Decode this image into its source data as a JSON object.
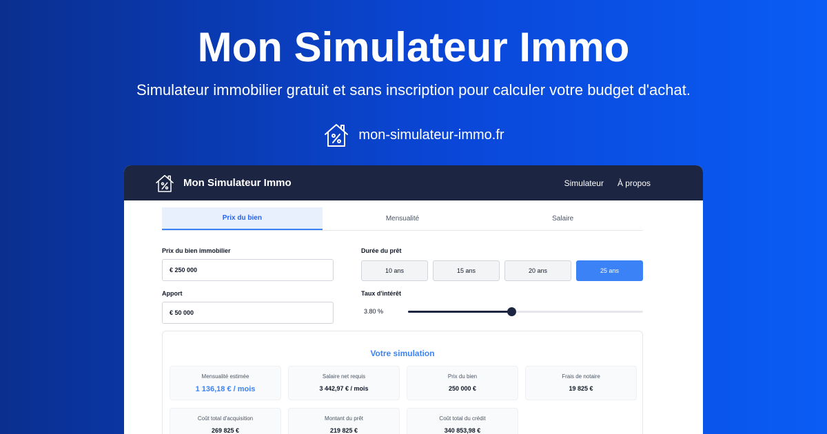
{
  "hero": {
    "title": "Mon Simulateur Immo",
    "subtitle": "Simulateur immobilier gratuit et sans inscription pour calculer votre budget d'achat.",
    "domain": "mon-simulateur-immo.fr",
    "logo_icon": "house-percent-icon"
  },
  "navbar": {
    "brand": "Mon Simulateur Immo",
    "links": [
      "Simulateur",
      "À propos"
    ]
  },
  "tabs": [
    {
      "label": "Prix du bien",
      "active": true
    },
    {
      "label": "Mensualité",
      "active": false
    },
    {
      "label": "Salaire",
      "active": false
    }
  ],
  "form": {
    "price_label": "Prix du bien immobilier",
    "price_value": "€ 250 000",
    "apport_label": "Apport",
    "apport_value": "€ 50 000",
    "duration_label": "Durée du prêt",
    "durations": [
      "10 ans",
      "15 ans",
      "20 ans",
      "25 ans"
    ],
    "duration_selected": "25 ans",
    "rate_label": "Taux d'intérêt",
    "rate_value": "3.80 %",
    "rate_slider_fraction": 0.44
  },
  "results": {
    "title": "Votre simulation",
    "stats": [
      {
        "label": "Mensualité estimée",
        "value": "1 136,18 € / mois"
      },
      {
        "label": "Salaire net requis",
        "value": "3 442,97 € / mois"
      },
      {
        "label": "Prix du bien",
        "value": "250 000 €"
      },
      {
        "label": "Frais de notaire",
        "value": "19 825 €"
      },
      {
        "label": "Coût total d'acquisition",
        "value": "269 825 €"
      },
      {
        "label": "Montant du prêt",
        "value": "219 825 €"
      },
      {
        "label": "Coût total du crédit",
        "value": "340 853,98 €"
      }
    ]
  },
  "colors": {
    "accent": "#3b82f6",
    "navbar": "#1c2541",
    "hero_gradient_start": "#0a2f8f",
    "hero_gradient_end": "#0a5cf5"
  }
}
